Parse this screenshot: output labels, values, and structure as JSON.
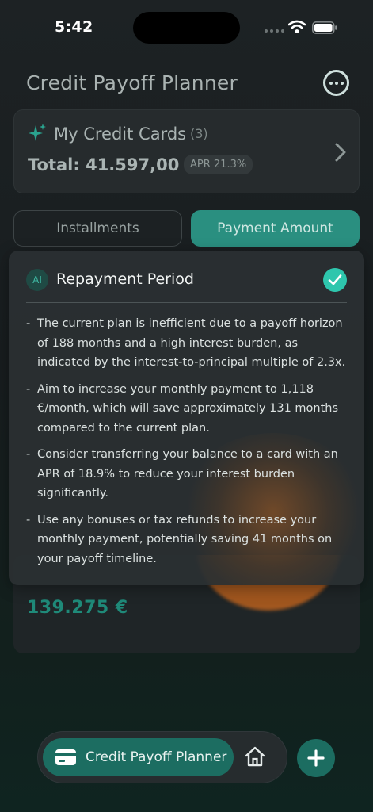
{
  "status_bar": {
    "time": "5:42"
  },
  "header": {
    "title": "Credit Payoff Planner"
  },
  "cards_summary": {
    "title": "My Credit Cards",
    "count": "(3)",
    "total": "Total: 41.597,00 €",
    "apr": "APR 21.3%"
  },
  "tabs": [
    {
      "label": "Installments",
      "active": false
    },
    {
      "label": "Payment Amount",
      "active": true
    }
  ],
  "overlay": {
    "badge": "AI",
    "title": "Repayment Period",
    "bullets": [
      "The current plan is inefficient due to a payoff horizon of 188 months and a high interest burden, as indicated by the interest-to-principal multiple of 2.3x.",
      "Aim to increase your monthly payment to 1,118 €/month, which will save approximately 131 months compared to the current plan.",
      "Consider transferring your balance to a card with an APR of 18.9% to reduce your interest burden significantly.",
      "Use any bonuses or tax refunds to increase your monthly payment, potentially saving 41 months on your payoff timeline."
    ],
    "bullet_dash": "-"
  },
  "background_card": {
    "amount": "139.275 €"
  },
  "bottom_nav": {
    "active_label": "Credit Payoff Planner"
  },
  "colors": {
    "accent": "#2a8f80",
    "accent_dark": "#1c6d61",
    "check": "#2ec6ad",
    "orange": "#b8601e"
  }
}
